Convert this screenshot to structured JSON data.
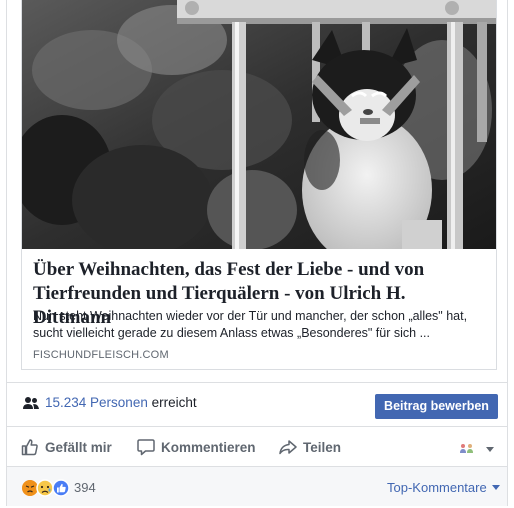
{
  "link_card": {
    "title": "Über Weihnachten, das Fest der Liebe - und von Tierfreunden und Tierquälern - von Ulrich H. Dittmann",
    "description": "Nun steht Weihnachten wieder vor der Tür und mancher, der schon „alles\" hat, sucht vielleicht gerade zu diesem Anlass etwas „Besonderes\" für sich ...",
    "domain": "FISCHUNDFLEISCH.COM"
  },
  "reach": {
    "count_text": "15.234 Personen",
    "suffix": "erreicht",
    "promote_label": "Beitrag bewerben"
  },
  "actions": {
    "like": "Gefällt mir",
    "comment": "Kommentieren",
    "share": "Teilen"
  },
  "reactions": {
    "count": "394",
    "icons": [
      "angry-icon",
      "sad-icon",
      "like-icon"
    ],
    "sort_label": "Top-Kommentare"
  },
  "colors": {
    "link_blue": "#4267b2",
    "muted_text": "#606770",
    "border": "#dddfe2"
  }
}
